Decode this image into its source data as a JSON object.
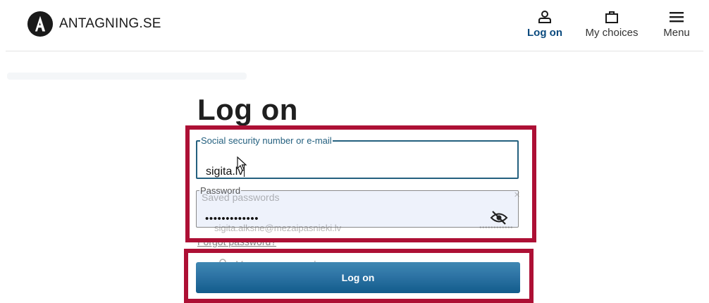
{
  "header": {
    "brand": "ANTAGNING.SE",
    "nav": {
      "login": "Log on",
      "choices": "My choices",
      "menu": "Menu"
    }
  },
  "page": {
    "title": "Log on"
  },
  "form": {
    "ssn": {
      "legend": "Social security number or e-mail",
      "value": "sigita.lv"
    },
    "password": {
      "legend": "Password",
      "value": "•••••••••••••"
    },
    "forgot_password": "Forgot password?",
    "submit_label": "Log on"
  },
  "autofill": {
    "title": "Saved passwords",
    "close": "×",
    "saved_email": "sigita.alksne@mezaipasnieki.lv",
    "saved_password_mask": "••••••••••••",
    "manage_label": "Manage passwords"
  },
  "colors": {
    "accent": "#0a4a7e",
    "field_focus": "#24607f",
    "highlight": "#ad1035",
    "button": "#2d73a4"
  }
}
